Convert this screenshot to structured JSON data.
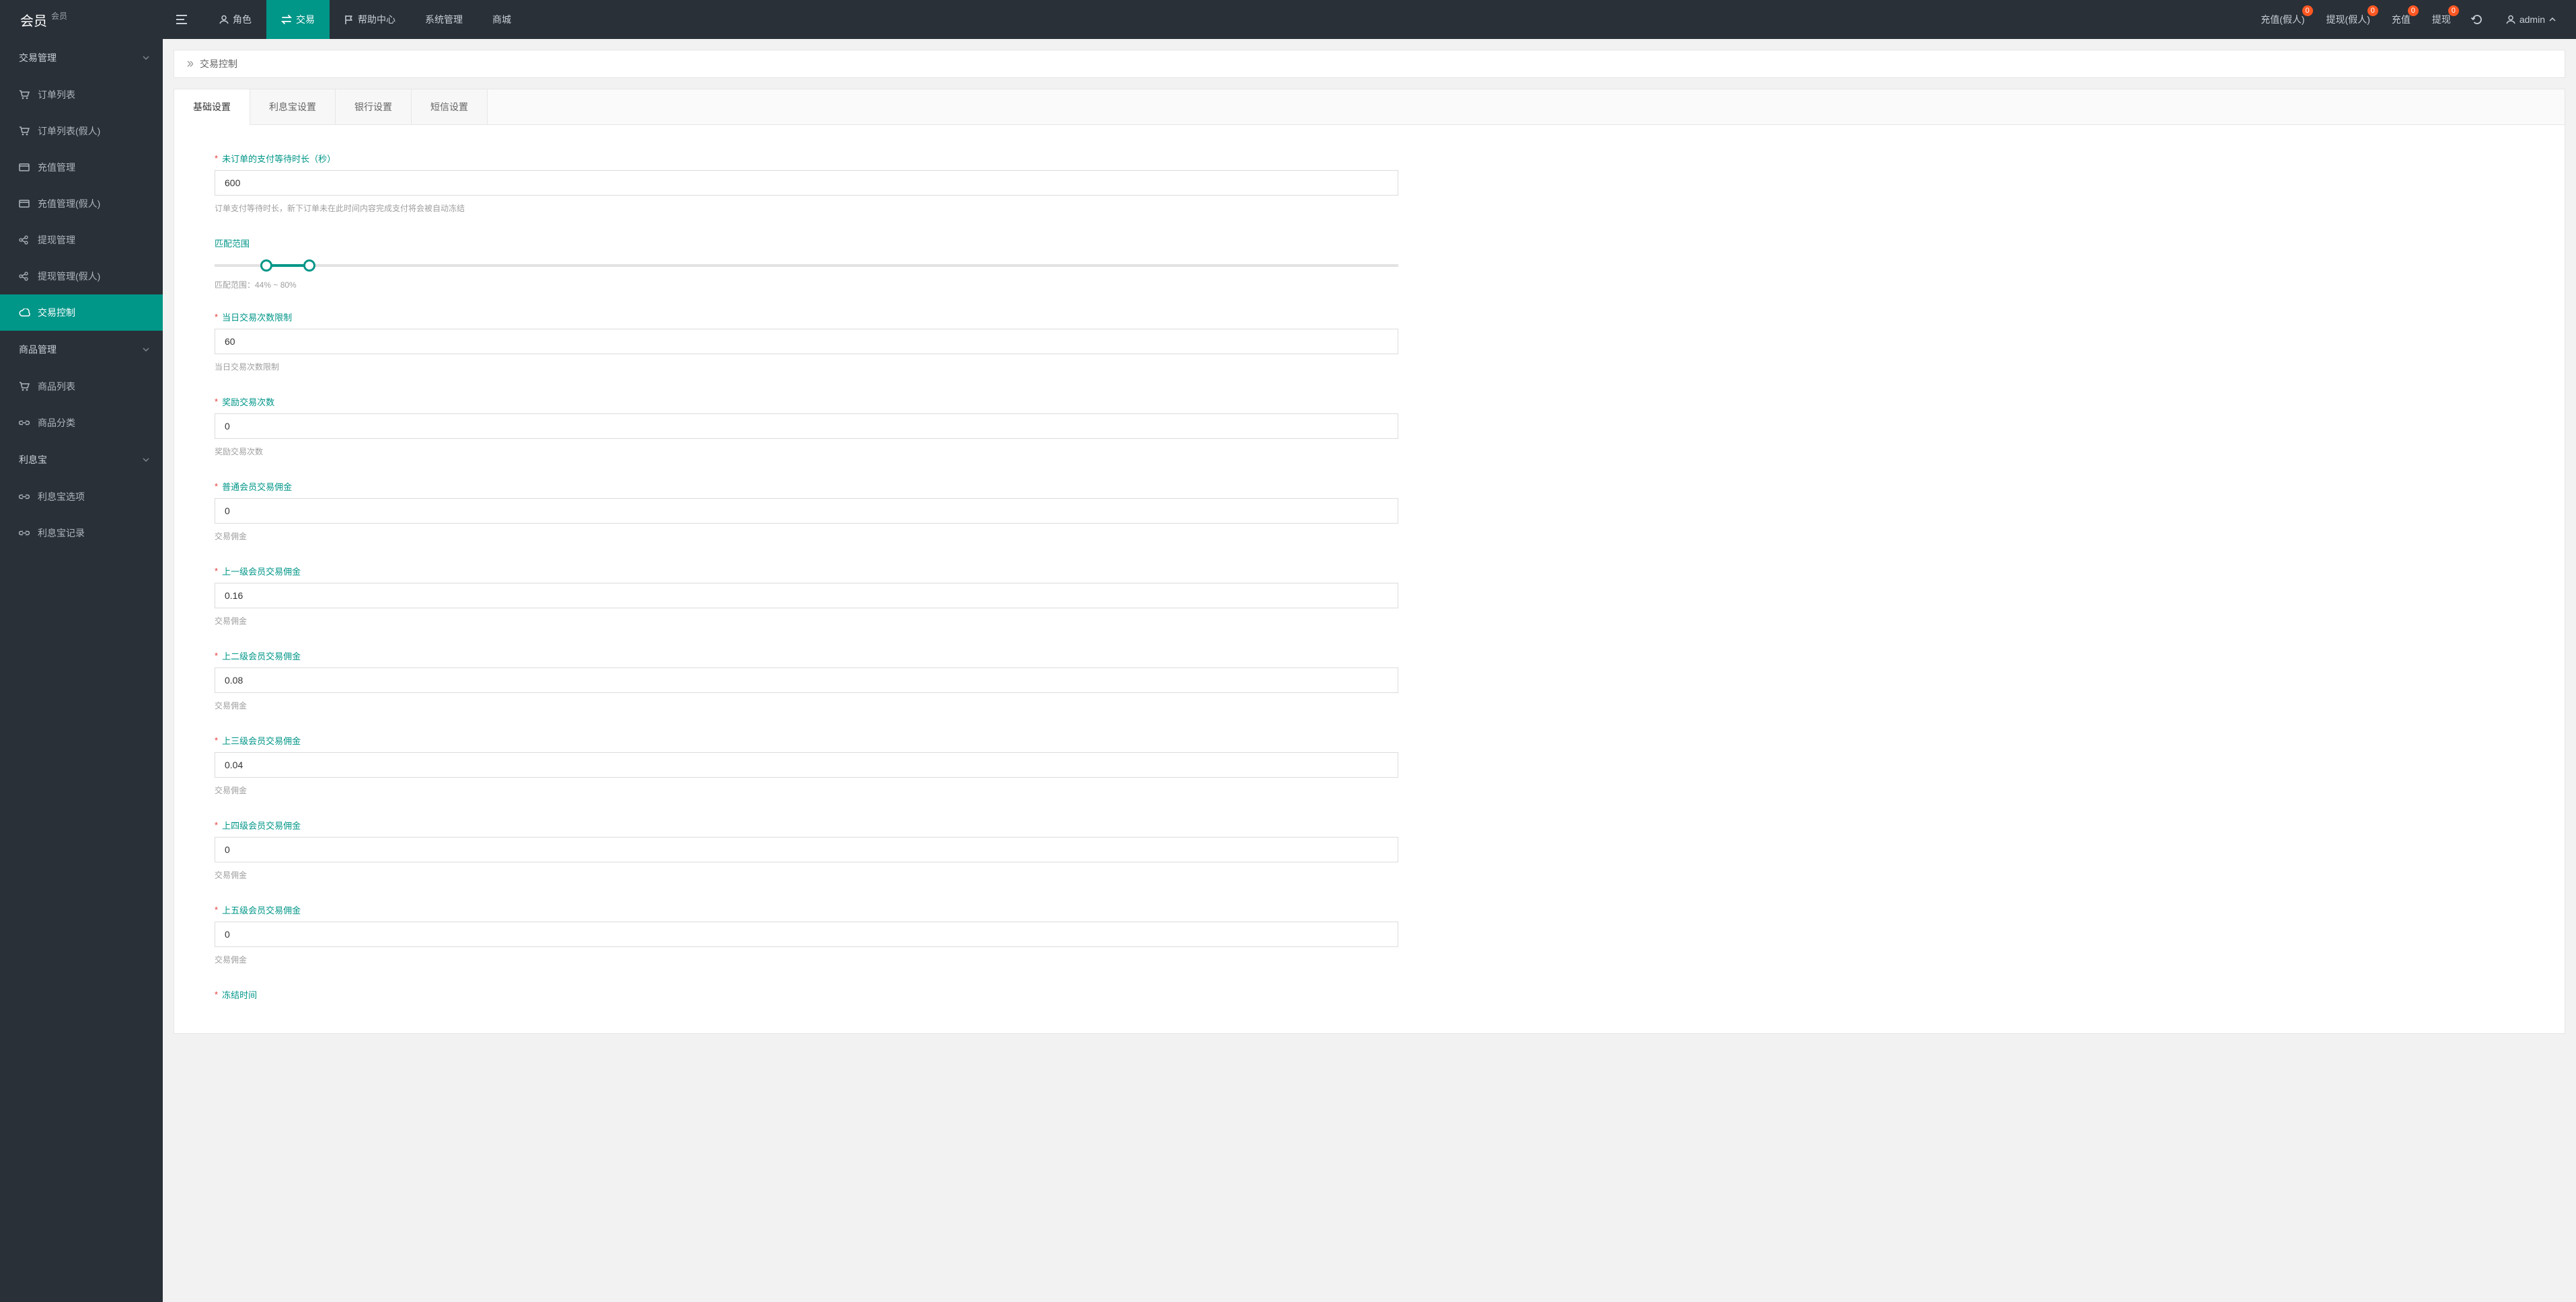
{
  "brand": {
    "title": "会员",
    "subtitle": "会员"
  },
  "topnav": [
    {
      "label": "角色",
      "icon": "user"
    },
    {
      "label": "交易",
      "icon": "transaction",
      "active": true
    },
    {
      "label": "帮助中心",
      "icon": "flag"
    },
    {
      "label": "系统管理",
      "icon": ""
    },
    {
      "label": "商城",
      "icon": ""
    }
  ],
  "topright": {
    "recharge_fake": {
      "label": "充值(假人)",
      "badge": "0"
    },
    "withdraw_fake": {
      "label": "提现(假人)",
      "badge": "0"
    },
    "recharge": {
      "label": "充值",
      "badge": "0"
    },
    "withdraw": {
      "label": "提现",
      "badge": "0"
    },
    "user": "admin"
  },
  "breadcrumb": {
    "current": "交易控制"
  },
  "sidebar": [
    {
      "type": "group",
      "label": "交易管理",
      "open": true,
      "items": [
        {
          "label": "订单列表",
          "icon": "cart"
        },
        {
          "label": "订单列表(假人)",
          "icon": "cart"
        },
        {
          "label": "充值管理",
          "icon": "card"
        },
        {
          "label": "充值管理(假人)",
          "icon": "card"
        },
        {
          "label": "提现管理",
          "icon": "share"
        },
        {
          "label": "提现管理(假人)",
          "icon": "share"
        },
        {
          "label": "交易控制",
          "icon": "cloud",
          "active": true
        }
      ]
    },
    {
      "type": "group",
      "label": "商品管理",
      "open": true,
      "items": [
        {
          "label": "商品列表",
          "icon": "cart2"
        },
        {
          "label": "商品分类",
          "icon": "link"
        }
      ]
    },
    {
      "type": "group",
      "label": "利息宝",
      "open": true,
      "items": [
        {
          "label": "利息宝选项",
          "icon": "link"
        },
        {
          "label": "利息宝记录",
          "icon": "link"
        }
      ]
    }
  ],
  "tabs": [
    {
      "label": "基础设置",
      "active": true
    },
    {
      "label": "利息宝设置"
    },
    {
      "label": "银行设置"
    },
    {
      "label": "短信设置"
    }
  ],
  "fields": {
    "payment_wait": {
      "label": "未订单的支付等待时长（秒）",
      "value": "600",
      "help": "订单支付等待时长，新下订单未在此时间内容完成支付将会被自动冻结"
    },
    "range": {
      "label": "匹配范围",
      "low": 44,
      "high": 80,
      "help": "匹配范围：44% ~ 80%"
    },
    "daily_limit": {
      "label": "当日交易次数限制",
      "value": "60",
      "help": "当日交易次数限制"
    },
    "bonus_count": {
      "label": "奖励交易次数",
      "value": "0",
      "help": "奖励交易次数"
    },
    "comm_normal": {
      "label": "普通会员交易佣金",
      "value": "0",
      "help": "交易佣金"
    },
    "comm_l1": {
      "label": "上一级会员交易佣金",
      "value": "0.16",
      "help": "交易佣金"
    },
    "comm_l2": {
      "label": "上二级会员交易佣金",
      "value": "0.08",
      "help": "交易佣金"
    },
    "comm_l3": {
      "label": "上三级会员交易佣金",
      "value": "0.04",
      "help": "交易佣金"
    },
    "comm_l4": {
      "label": "上四级会员交易佣金",
      "value": "0",
      "help": "交易佣金"
    },
    "comm_l5": {
      "label": "上五级会员交易佣金",
      "value": "0",
      "help": "交易佣金"
    },
    "freeze_time": {
      "label": "冻结时间"
    }
  }
}
